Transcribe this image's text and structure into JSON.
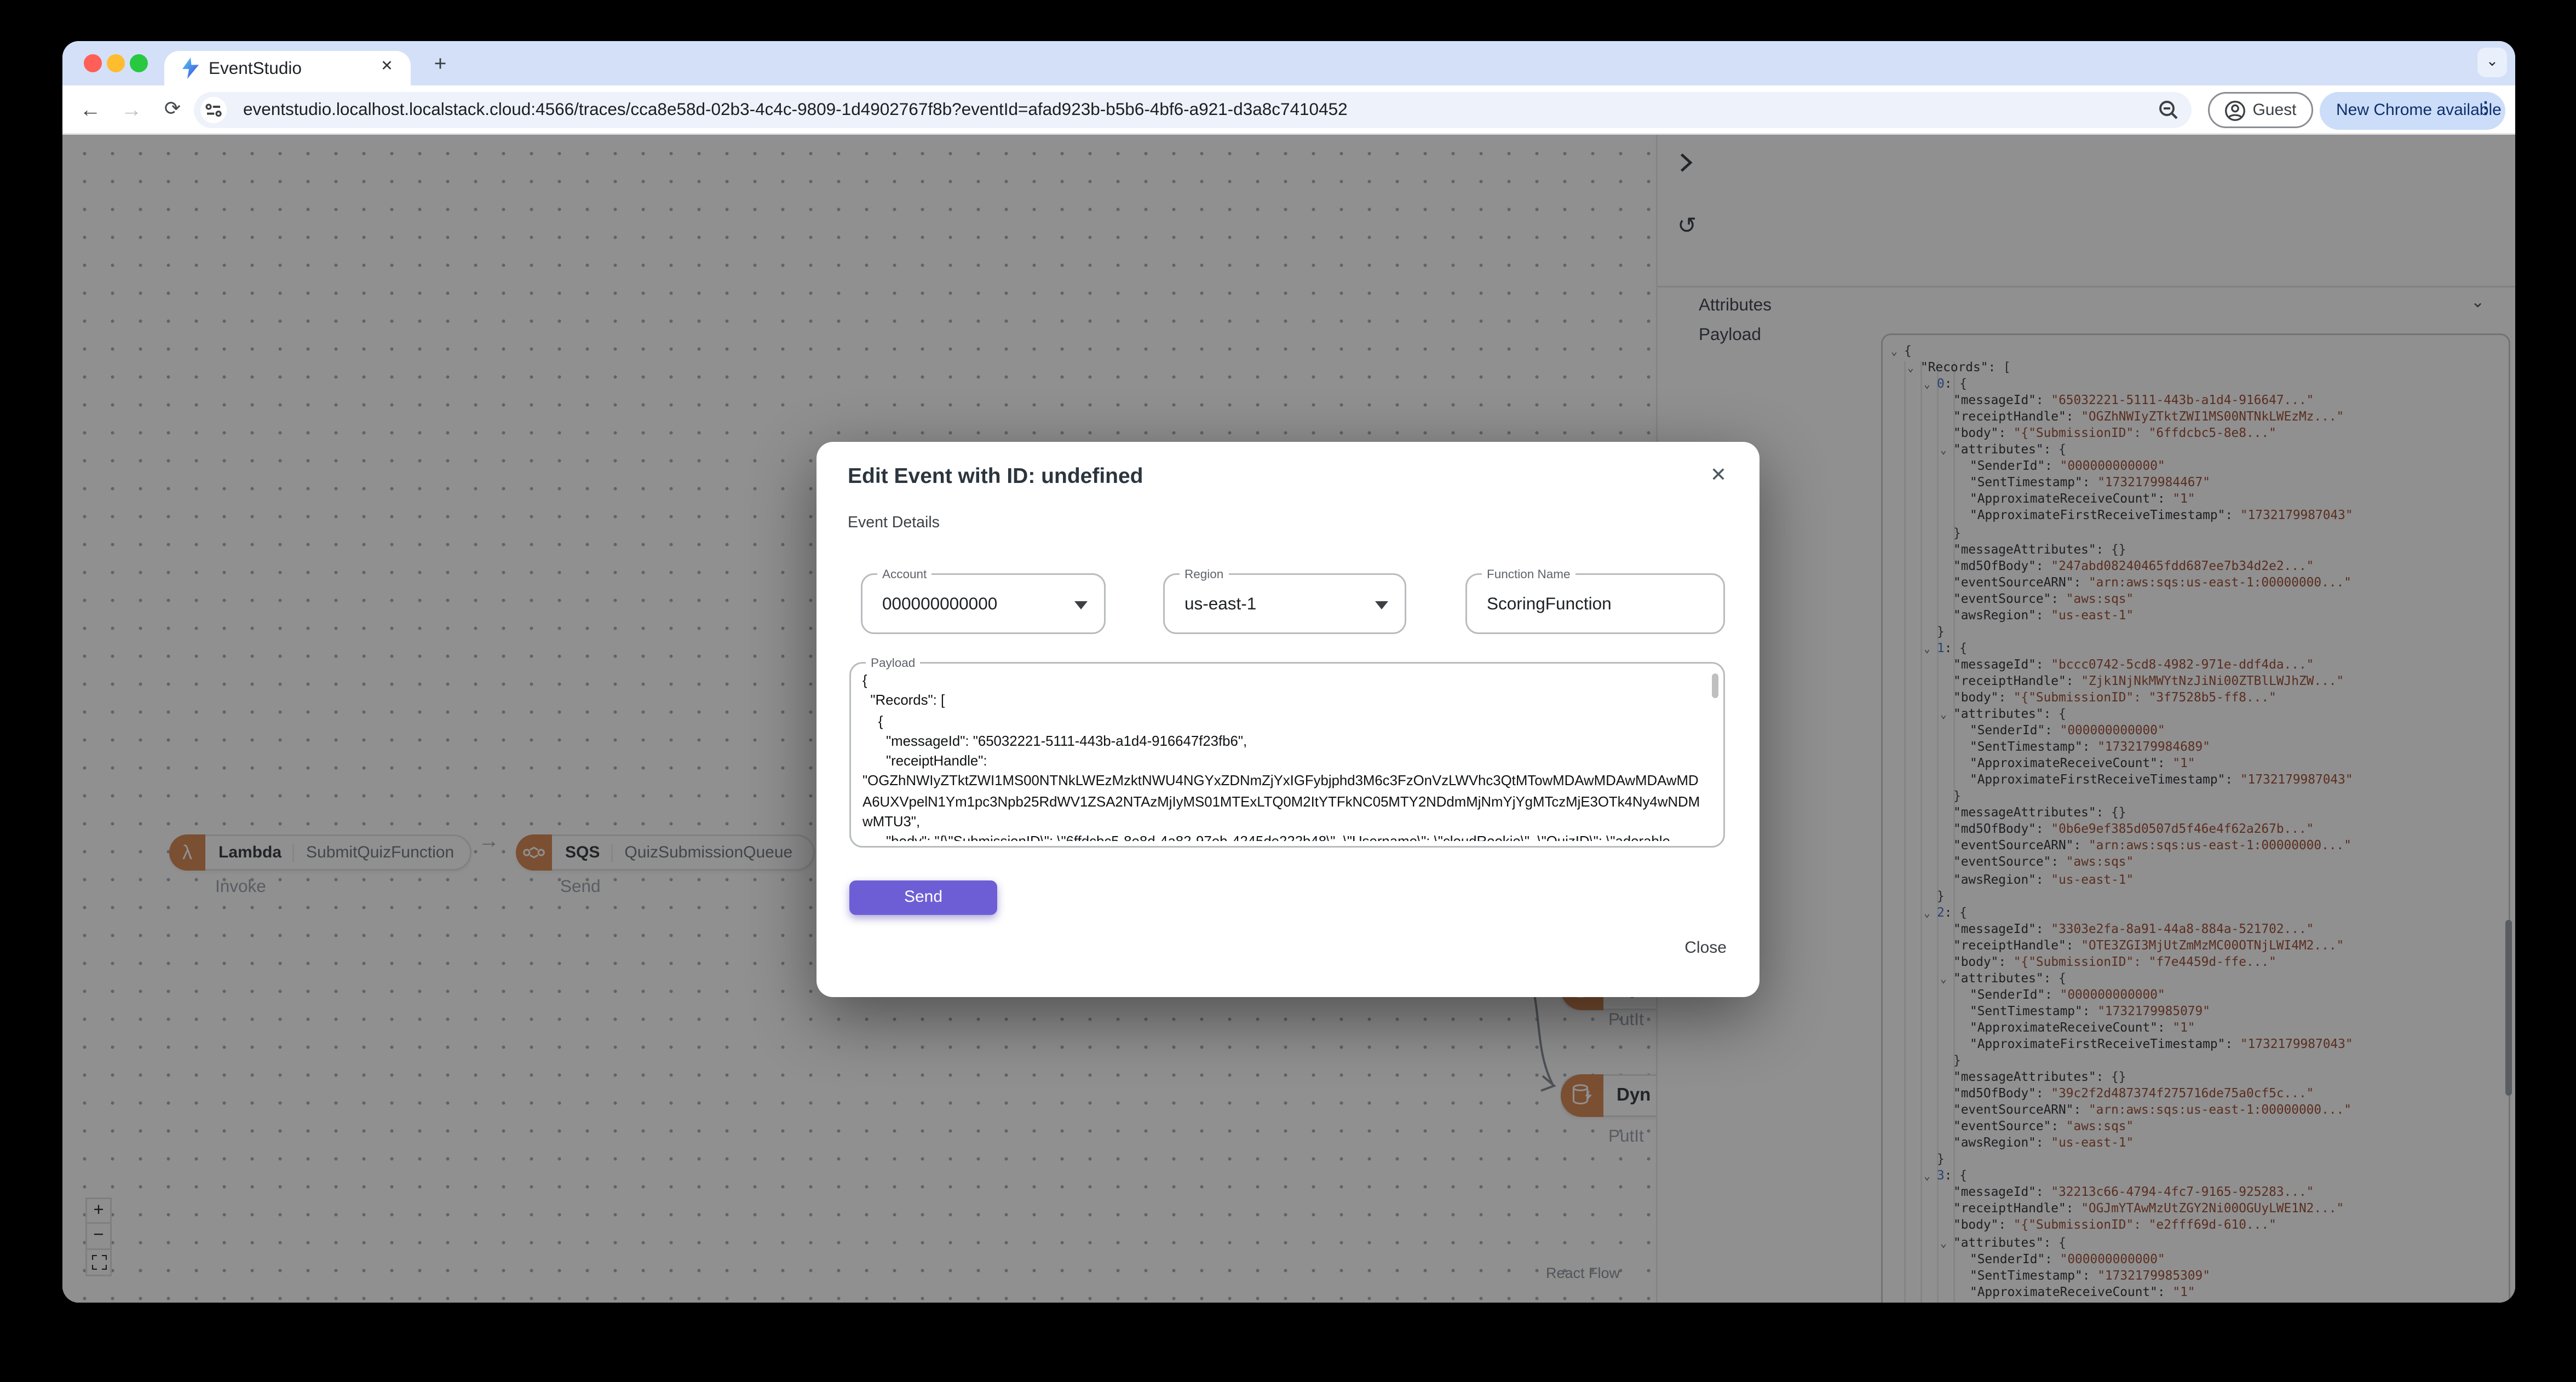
{
  "browser": {
    "tab_title": "EventStudio",
    "url": "eventstudio.localhost.localstack.cloud:4566/traces/cca8e58d-02b3-4c4c-9809-1d4902767f8b?eventId=afad923b-b5b6-4bf6-a921-d3a8c7410452",
    "guest_label": "Guest",
    "update_label": "New Chrome available",
    "new_tab_glyph": "+",
    "tab_close_glyph": "✕",
    "tab_search_glyph": "⌄",
    "back_glyph": "←",
    "forward_glyph": "→",
    "reload_glyph": "⟳",
    "kebab_glyph": "⋮"
  },
  "colors": {
    "accent_purple": "#6e5ed6",
    "node_icon_orange": "#d98851",
    "json_value": "#9e4a2b",
    "json_index": "#3d72c4",
    "tabstrip_bg": "#d3e0f8",
    "update_pill_bg": "#cbddf8",
    "update_pill_text": "#0f2f6b"
  },
  "canvas": {
    "nodes": [
      {
        "service": "Lambda",
        "name": "SubmitQuizFunction",
        "operation": "Invoke"
      },
      {
        "service": "SQS",
        "name": "QuizSubmissionQueue",
        "operation": "Send"
      },
      {
        "service": "Dyn",
        "name": "",
        "operation": "PutIt"
      },
      {
        "service": "Dyn",
        "name": "",
        "operation": "PutIt"
      }
    ],
    "edge_arrow_glyph": "→",
    "controls": {
      "zoom_in": "+",
      "zoom_out": "−"
    },
    "attribution": "React Flow"
  },
  "panel": {
    "collapse_glyph": "›",
    "refresh_glyph": "↺",
    "attributes_label": "Attributes",
    "attributes_chevron": "⌄",
    "payload_label": "Payload",
    "json_lines": [
      [
        0,
        1,
        "{",
        "b",
        null
      ],
      [
        1,
        1,
        "\"Records\"",
        "k",
        "["
      ],
      [
        2,
        1,
        "0",
        "i",
        "{"
      ],
      [
        3,
        0,
        "\"messageId\"",
        "k",
        "\"65032221-5111-443b-a1d4-916647...\""
      ],
      [
        3,
        0,
        "\"receiptHandle\"",
        "k",
        "\"OGZhNWIyZTktZWI1MS00NTNkLWEzMz...\""
      ],
      [
        3,
        0,
        "\"body\"",
        "k",
        "\"{\"SubmissionID\": \"6ffdcbc5-8e8...\""
      ],
      [
        3,
        1,
        "\"attributes\"",
        "k",
        "{"
      ],
      [
        4,
        0,
        "\"SenderId\"",
        "k",
        "\"000000000000\""
      ],
      [
        4,
        0,
        "\"SentTimestamp\"",
        "k",
        "\"1732179984467\""
      ],
      [
        4,
        0,
        "\"ApproximateReceiveCount\"",
        "k",
        "\"1\""
      ],
      [
        4,
        0,
        "\"ApproximateFirstReceiveTimestamp\"",
        "k",
        "\"1732179987043\""
      ],
      [
        3,
        0,
        "}",
        "b",
        null
      ],
      [
        3,
        0,
        "\"messageAttributes\"",
        "k",
        "{}"
      ],
      [
        3,
        0,
        "\"md5OfBody\"",
        "k",
        "\"247abd08240465fdd687ee7b34d2e2...\""
      ],
      [
        3,
        0,
        "\"eventSourceARN\"",
        "k",
        "\"arn:aws:sqs:us-east-1:00000000...\""
      ],
      [
        3,
        0,
        "\"eventSource\"",
        "k",
        "\"aws:sqs\""
      ],
      [
        3,
        0,
        "\"awsRegion\"",
        "k",
        "\"us-east-1\""
      ],
      [
        2,
        0,
        "}",
        "b",
        null
      ],
      [
        2,
        1,
        "1",
        "i",
        "{"
      ],
      [
        3,
        0,
        "\"messageId\"",
        "k",
        "\"bccc0742-5cd8-4982-971e-ddf4da...\""
      ],
      [
        3,
        0,
        "\"receiptHandle\"",
        "k",
        "\"Zjk1NjNkMWYtNzJiNi00ZTBlLWJhZW...\""
      ],
      [
        3,
        0,
        "\"body\"",
        "k",
        "\"{\"SubmissionID\": \"3f7528b5-ff8...\""
      ],
      [
        3,
        1,
        "\"attributes\"",
        "k",
        "{"
      ],
      [
        4,
        0,
        "\"SenderId\"",
        "k",
        "\"000000000000\""
      ],
      [
        4,
        0,
        "\"SentTimestamp\"",
        "k",
        "\"1732179984689\""
      ],
      [
        4,
        0,
        "\"ApproximateReceiveCount\"",
        "k",
        "\"1\""
      ],
      [
        4,
        0,
        "\"ApproximateFirstReceiveTimestamp\"",
        "k",
        "\"1732179987043\""
      ],
      [
        3,
        0,
        "}",
        "b",
        null
      ],
      [
        3,
        0,
        "\"messageAttributes\"",
        "k",
        "{}"
      ],
      [
        3,
        0,
        "\"md5OfBody\"",
        "k",
        "\"0b6e9ef385d0507d5f46e4f62a267b...\""
      ],
      [
        3,
        0,
        "\"eventSourceARN\"",
        "k",
        "\"arn:aws:sqs:us-east-1:00000000...\""
      ],
      [
        3,
        0,
        "\"eventSource\"",
        "k",
        "\"aws:sqs\""
      ],
      [
        3,
        0,
        "\"awsRegion\"",
        "k",
        "\"us-east-1\""
      ],
      [
        2,
        0,
        "}",
        "b",
        null
      ],
      [
        2,
        1,
        "2",
        "i",
        "{"
      ],
      [
        3,
        0,
        "\"messageId\"",
        "k",
        "\"3303e2fa-8a91-44a8-884a-521702...\""
      ],
      [
        3,
        0,
        "\"receiptHandle\"",
        "k",
        "\"OTE3ZGI3MjUtZmMzMC00OTNjLWI4M2...\""
      ],
      [
        3,
        0,
        "\"body\"",
        "k",
        "\"{\"SubmissionID\": \"f7e4459d-ffe...\""
      ],
      [
        3,
        1,
        "\"attributes\"",
        "k",
        "{"
      ],
      [
        4,
        0,
        "\"SenderId\"",
        "k",
        "\"000000000000\""
      ],
      [
        4,
        0,
        "\"SentTimestamp\"",
        "k",
        "\"1732179985079\""
      ],
      [
        4,
        0,
        "\"ApproximateReceiveCount\"",
        "k",
        "\"1\""
      ],
      [
        4,
        0,
        "\"ApproximateFirstReceiveTimestamp\"",
        "k",
        "\"1732179987043\""
      ],
      [
        3,
        0,
        "}",
        "b",
        null
      ],
      [
        3,
        0,
        "\"messageAttributes\"",
        "k",
        "{}"
      ],
      [
        3,
        0,
        "\"md5OfBody\"",
        "k",
        "\"39c2f2d487374f275716de75a0cf5c...\""
      ],
      [
        3,
        0,
        "\"eventSourceARN\"",
        "k",
        "\"arn:aws:sqs:us-east-1:00000000...\""
      ],
      [
        3,
        0,
        "\"eventSource\"",
        "k",
        "\"aws:sqs\""
      ],
      [
        3,
        0,
        "\"awsRegion\"",
        "k",
        "\"us-east-1\""
      ],
      [
        2,
        0,
        "}",
        "b",
        null
      ],
      [
        2,
        1,
        "3",
        "i",
        "{"
      ],
      [
        3,
        0,
        "\"messageId\"",
        "k",
        "\"32213c66-4794-4fc7-9165-925283...\""
      ],
      [
        3,
        0,
        "\"receiptHandle\"",
        "k",
        "\"OGJmYTAwMzUtZGY2Ni00OGUyLWE1N2...\""
      ],
      [
        3,
        0,
        "\"body\"",
        "k",
        "\"{\"SubmissionID\": \"e2fff69d-610...\""
      ],
      [
        3,
        1,
        "\"attributes\"",
        "k",
        "{"
      ],
      [
        4,
        0,
        "\"SenderId\"",
        "k",
        "\"000000000000\""
      ],
      [
        4,
        0,
        "\"SentTimestamp\"",
        "k",
        "\"1732179985309\""
      ],
      [
        4,
        0,
        "\"ApproximateReceiveCount\"",
        "k",
        "\"1\""
      ]
    ]
  },
  "modal": {
    "title": "Edit Event with ID: undefined",
    "close_icon_glyph": "✕",
    "section_label": "Event Details",
    "fields": {
      "account": {
        "label": "Account",
        "value": "000000000000"
      },
      "region": {
        "label": "Region",
        "value": "us-east-1"
      },
      "function_name": {
        "label": "Function Name",
        "value": "ScoringFunction"
      }
    },
    "payload": {
      "label": "Payload",
      "text": "{\n  \"Records\": [\n    {\n      \"messageId\": \"65032221-5111-443b-a1d4-916647f23fb6\",\n      \"receiptHandle\": \"OGZhNWIyZTktZWI1MS00NTNkLWEzMzktNWU4NGYxZDNmZjYxIGFybjphd3M6c3FzOnVzLWVhc3QtMTowMDAwMDAwMDAwMDA6UXVpelN1Ym1pc3Npb25RdWV1ZSA2NTAzMjIyMS01MTExLTQ0M2ItYTFkNC05MTY2NDdmMjNmYjYgMTczMjE3OTk4Ny4wNDMwMTU3\",\n      \"body\": \"{\\\"SubmissionID\\\": \\\"6ffdcbc5-8e8d-4a82-97eb-4245de222b48\\\", \\\"Username\\\": \\\"cloudRookie\\\", \\\"QuizID\\\": \\\"adorable-"
    },
    "send_label": "Send",
    "close_label": "Close"
  }
}
